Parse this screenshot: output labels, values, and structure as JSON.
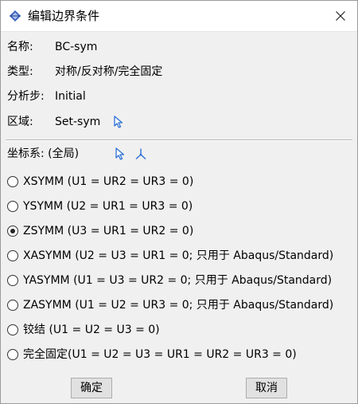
{
  "window": {
    "title": "编辑边界条件",
    "close_symbol": "✕"
  },
  "fields": {
    "name_label": "名称:",
    "name_value": "BC-sym",
    "type_label": "类型:",
    "type_value": "对称/反对称/完全固定",
    "step_label": "分析步:",
    "step_value": "Initial",
    "region_label": "区域:",
    "region_value": "Set-sym",
    "csys_label": "坐标系: (全局)"
  },
  "options": [
    {
      "label": "XSYMM (U1 = UR2 = UR3 = 0)",
      "checked": false
    },
    {
      "label": "YSYMM (U2 = UR1 = UR3 = 0)",
      "checked": false
    },
    {
      "label": "ZSYMM (U3 = UR1 = UR2 = 0)",
      "checked": true
    },
    {
      "label": "XASYMM (U2 = U3 = UR1 = 0; 只用于 Abaqus/Standard)",
      "checked": false
    },
    {
      "label": "YASYMM (U1 = U3 = UR2 = 0; 只用于 Abaqus/Standard)",
      "checked": false
    },
    {
      "label": "ZASYMM (U1 = U2 = UR3 = 0; 只用于 Abaqus/Standard)",
      "checked": false
    },
    {
      "label": "铰结 (U1 = U2 = U3 = 0)",
      "checked": false
    },
    {
      "label": "完全固定(U1 = U2 = U3 = UR1 = UR2 = UR3 = 0)",
      "checked": false
    }
  ],
  "buttons": {
    "ok": "确定",
    "cancel": "取消"
  },
  "colors": {
    "accent_icon": "#2b6fd6",
    "title_icon": "#3b5fb8"
  },
  "icons": {
    "title": "boundary-condition-icon",
    "region_pick": "select-arrow-icon",
    "csys_pick": "select-arrow-icon",
    "csys_axes": "axes-triad-icon"
  }
}
